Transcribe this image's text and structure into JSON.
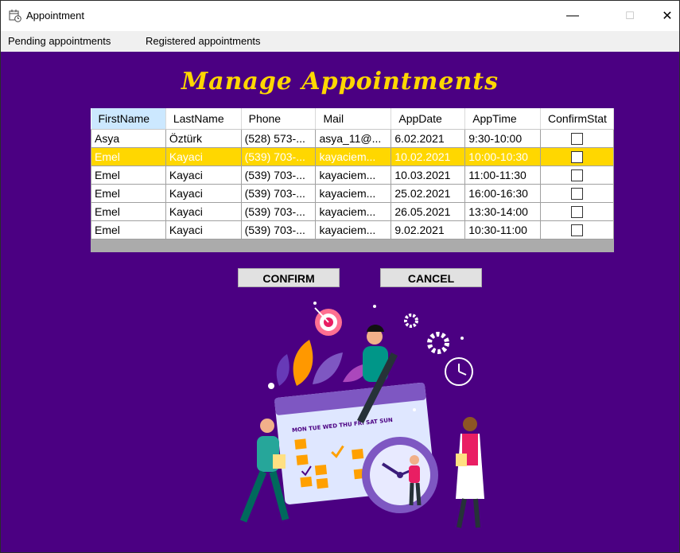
{
  "window": {
    "title": "Appointment",
    "minimize": "—",
    "maximize": "☐",
    "close": "✕"
  },
  "menu": {
    "items": [
      "Pending appointments",
      "Registered appointments"
    ]
  },
  "heading": "Manage Appointments",
  "table": {
    "columns": [
      "FirstName",
      "LastName",
      "Phone",
      "Mail",
      "AppDate",
      "AppTime",
      "ConfirmStat"
    ],
    "rows": [
      [
        "Asya",
        "Öztürk",
        "(528) 573-...",
        "asya_11@...",
        "6.02.2021",
        "9:30-10:00"
      ],
      [
        "Emel",
        "Kayaci",
        "(539) 703-...",
        "kayaciem...",
        "10.02.2021",
        "10:00-10:30"
      ],
      [
        "Emel",
        "Kayaci",
        "(539) 703-...",
        "kayaciem...",
        "10.03.2021",
        "11:00-11:30"
      ],
      [
        "Emel",
        "Kayaci",
        "(539) 703-...",
        "kayaciem...",
        "25.02.2021",
        "16:00-16:30"
      ],
      [
        "Emel",
        "Kayaci",
        "(539) 703-...",
        "kayaciem...",
        "26.05.2021",
        "13:30-14:00"
      ],
      [
        "Emel",
        "Kayaci",
        "(539) 703-...",
        "kayaciem...",
        "9.02.2021",
        "10:30-11:00"
      ]
    ],
    "confirmed": [
      false,
      false,
      false,
      false,
      false,
      false
    ],
    "selected_row": 2
  },
  "buttons": {
    "confirm": "CONFIRM",
    "cancel": "CANCEL"
  },
  "illustration": {
    "calendar_days": "MON  TUE  WED  THU  FRI  SAT  SUN",
    "icons": [
      "target-icon",
      "gear-icon",
      "clock-icon",
      "calendar-icon"
    ]
  },
  "colors": {
    "background": "#4b0082",
    "accent": "#ffd700",
    "selection": "#ffd700"
  }
}
